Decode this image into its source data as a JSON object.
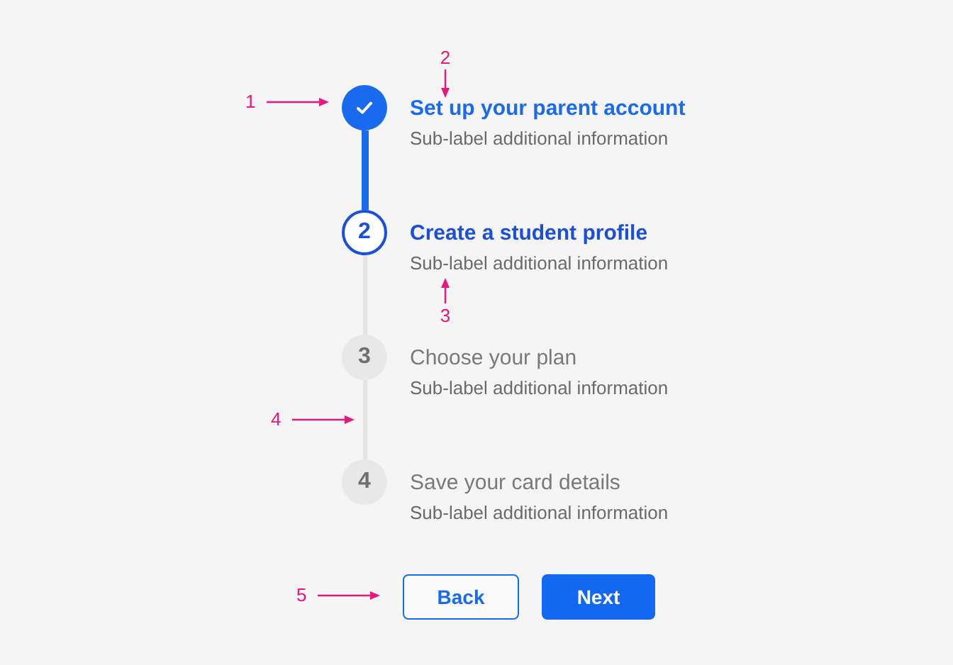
{
  "steps": [
    {
      "title": "Set up your parent account",
      "sublabel": "Sub-label additional information",
      "kind": "complete"
    },
    {
      "title": "Create a student profile",
      "sublabel": "Sub-label additional information",
      "kind": "current",
      "number": "2"
    },
    {
      "title": "Choose your plan",
      "sublabel": "Sub-label additional information",
      "kind": "upcoming",
      "number": "3"
    },
    {
      "title": "Save your card details",
      "sublabel": "Sub-label additional information",
      "kind": "upcoming",
      "number": "4"
    }
  ],
  "buttons": [
    {
      "label": "Back",
      "kind": "secondary"
    },
    {
      "label": "Next",
      "kind": "primary"
    }
  ],
  "annotations": [
    {
      "label": "1",
      "kind": "right"
    },
    {
      "label": "2",
      "kind": "down"
    },
    {
      "label": "3",
      "kind": "up"
    },
    {
      "label": "4",
      "kind": "right"
    },
    {
      "label": "5",
      "kind": "right"
    }
  ]
}
